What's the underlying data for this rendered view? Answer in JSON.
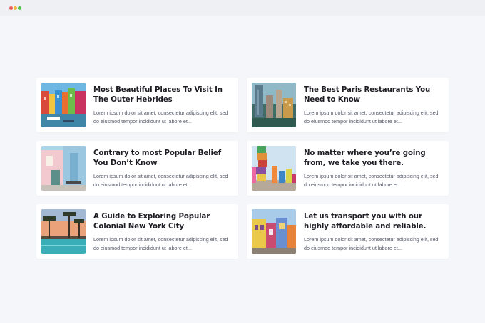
{
  "window": {
    "controls": [
      "close",
      "minimize",
      "maximize"
    ]
  },
  "posts": [
    {
      "title": "Most Beautiful Places To Visit In The Outer Hebrides",
      "excerpt": "Lorem ipsum dolor sit amet, consectetur adipiscing elit, sed do eiusmod tempor incididunt ut labore et...",
      "image": "colorful-canal-houses"
    },
    {
      "title": "The Best Paris Restaurants You Need to Know",
      "excerpt": "Lorem ipsum dolor sit amet, consectetur adipiscing elit, sed do eiusmod tempor incididunt ut labore et...",
      "image": "city-buildings-aerial"
    },
    {
      "title": "Contrary to most Popular Belief You Don’t Know",
      "excerpt": "Lorem ipsum dolor sit amet, consectetur adipiscing elit, sed do eiusmod tempor incididunt ut labore et...",
      "image": "pastel-building-facade"
    },
    {
      "title": "No matter where you’re going from, we take you there.",
      "excerpt": "Lorem ipsum dolor sit amet, consectetur adipiscing elit, sed do eiusmod tempor incididunt ut labore et...",
      "image": "colorful-stacked-sculptures"
    },
    {
      "title": "A Guide to Exploring Popular Colonial New York City",
      "excerpt": "Lorem ipsum dolor sit amet, consectetur adipiscing elit, sed do eiusmod tempor incididunt ut labore et...",
      "image": "palm-trees-pool-sunset"
    },
    {
      "title": "Let us transport you with our highly affordable and reliable.",
      "excerpt": "Lorem ipsum dolor sit amet, consectetur adipiscing elit, sed do eiusmod tempor incididunt ut labore et...",
      "image": "colorful-colonial-street"
    }
  ]
}
